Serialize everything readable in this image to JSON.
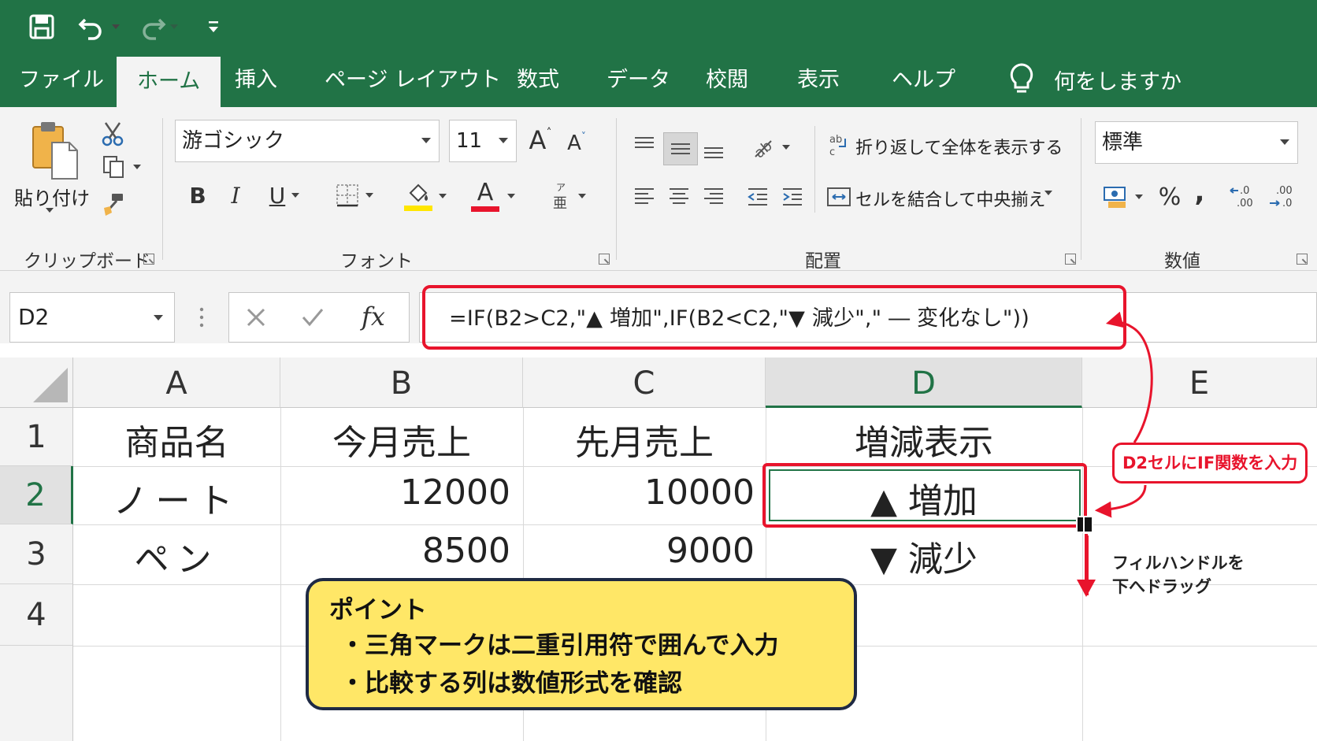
{
  "quick_access": {
    "save_icon": "save-icon",
    "undo_icon": "undo-icon",
    "redo_icon": "redo-icon",
    "customize_icon": "customize-icon"
  },
  "tabs": [
    "ファイル",
    "ホーム",
    "挿入",
    "ページ レイアウト",
    "数式",
    "データ",
    "校閲",
    "表示",
    "ヘルプ"
  ],
  "active_tab": "ホーム",
  "tell_me": "何をしますか",
  "ribbon": {
    "clipboard": {
      "label": "クリップボード",
      "paste": "貼り付け"
    },
    "font": {
      "label": "フォント",
      "font_name": "游ゴシック",
      "font_size": "11",
      "grow": "A",
      "shrink": "A",
      "bold": "B",
      "italic": "I",
      "underline": "U",
      "color": "A"
    },
    "alignment": {
      "label": "配置",
      "wrap": "折り返して全体を表示する",
      "merge": "セルを結合して中央揃え"
    },
    "number": {
      "label": "数値",
      "format": "標準",
      "percent": "%",
      "comma": ","
    }
  },
  "formula_bar": {
    "name_box": "D2",
    "fx": "fx",
    "formula": "=IF(B2>C2,\"▲ 増加\",IF(B2<C2,\"▼ 減少\",\" ― 変化なし\"))"
  },
  "sheet": {
    "columns": [
      "A",
      "B",
      "C",
      "D",
      "E"
    ],
    "selected_column": "D",
    "rows": [
      "1",
      "2",
      "3",
      "4"
    ],
    "selected_row": "2",
    "cells": {
      "A1": "商品名",
      "B1": "今月売上",
      "C1": "先月売上",
      "D1": "増減表示",
      "A2": "ノート",
      "B2": "12000",
      "C2": "10000",
      "D2": "▲ 増加",
      "A3": "ペン",
      "B3": "8500",
      "C3": "9000",
      "D3": "▼ 減少"
    }
  },
  "annotations": {
    "d2_label": "D2セルにIF関数を入力",
    "drag_line1": "フィルハンドルを",
    "drag_line2": "下へドラッグ",
    "accent_color": "#e8142c"
  },
  "callout": {
    "title": "ポイント",
    "line1": "・三角マークは二重引用符で囲んで入力",
    "line2": "・比較する列は数値形式を確認",
    "bg_color": "#ffe767"
  },
  "colors": {
    "excel_green": "#217346"
  }
}
